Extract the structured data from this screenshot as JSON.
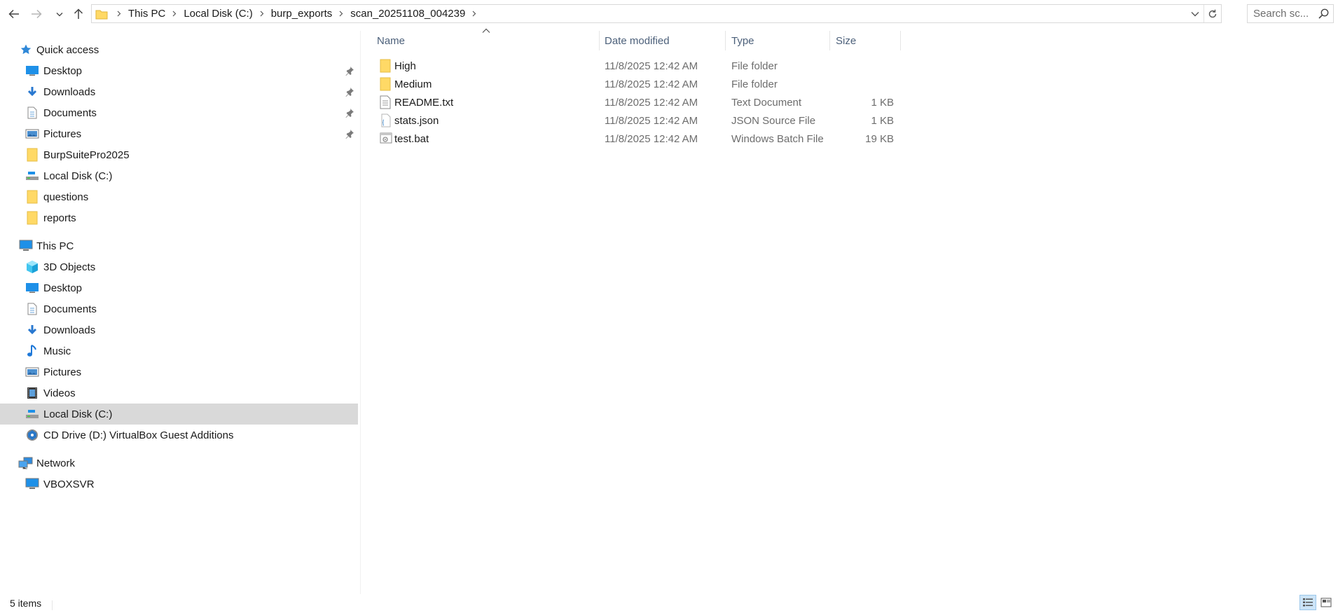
{
  "address_bar": {
    "breadcrumbs": [
      "This PC",
      "Local Disk (C:)",
      "burp_exports",
      "scan_20251108_004239"
    ]
  },
  "search": {
    "placeholder": "Search sc..."
  },
  "nav_pane": {
    "quick_access": {
      "label": "Quick access",
      "items": [
        {
          "label": "Desktop",
          "icon": "desktop-icon",
          "pinned": true
        },
        {
          "label": "Downloads",
          "icon": "downloads-icon",
          "pinned": true
        },
        {
          "label": "Documents",
          "icon": "documents-icon",
          "pinned": true
        },
        {
          "label": "Pictures",
          "icon": "pictures-icon",
          "pinned": true
        },
        {
          "label": "BurpSuitePro2025",
          "icon": "folder-icon",
          "pinned": false
        },
        {
          "label": "Local Disk (C:)",
          "icon": "drive-icon",
          "pinned": false
        },
        {
          "label": "questions",
          "icon": "folder-icon",
          "pinned": false
        },
        {
          "label": "reports",
          "icon": "folder-icon",
          "pinned": false
        }
      ]
    },
    "this_pc": {
      "label": "This PC",
      "items": [
        {
          "label": "3D Objects",
          "icon": "3d-objects-icon"
        },
        {
          "label": "Desktop",
          "icon": "desktop-icon"
        },
        {
          "label": "Documents",
          "icon": "documents-icon"
        },
        {
          "label": "Downloads",
          "icon": "downloads-icon"
        },
        {
          "label": "Music",
          "icon": "music-icon"
        },
        {
          "label": "Pictures",
          "icon": "pictures-icon"
        },
        {
          "label": "Videos",
          "icon": "videos-icon"
        },
        {
          "label": "Local Disk (C:)",
          "icon": "drive-icon",
          "selected": true
        },
        {
          "label": "CD Drive (D:) VirtualBox Guest Additions",
          "icon": "cd-drive-icon"
        }
      ]
    },
    "network": {
      "label": "Network",
      "items": [
        {
          "label": "VBOXSVR",
          "icon": "network-computer-icon"
        }
      ]
    }
  },
  "file_list": {
    "columns": [
      "Name",
      "Date modified",
      "Type",
      "Size"
    ],
    "rows": [
      {
        "name": "High",
        "date": "11/8/2025 12:42 AM",
        "type": "File folder",
        "size": "",
        "icon": "folder-icon"
      },
      {
        "name": "Medium",
        "date": "11/8/2025 12:42 AM",
        "type": "File folder",
        "size": "",
        "icon": "folder-icon"
      },
      {
        "name": "README.txt",
        "date": "11/8/2025 12:42 AM",
        "type": "Text Document",
        "size": "1 KB",
        "icon": "text-file-icon"
      },
      {
        "name": "stats.json",
        "date": "11/8/2025 12:42 AM",
        "type": "JSON Source File",
        "size": "1 KB",
        "icon": "json-file-icon"
      },
      {
        "name": "test.bat",
        "date": "11/8/2025 12:42 AM",
        "type": "Windows Batch File",
        "size": "19 KB",
        "icon": "batch-file-icon"
      }
    ]
  },
  "status_bar": {
    "item_count": "5 items"
  },
  "colors": {
    "folder": "#ffd966",
    "selection": "#d9d9d9",
    "header_text": "#4c607a",
    "accent": "#0078d7"
  }
}
